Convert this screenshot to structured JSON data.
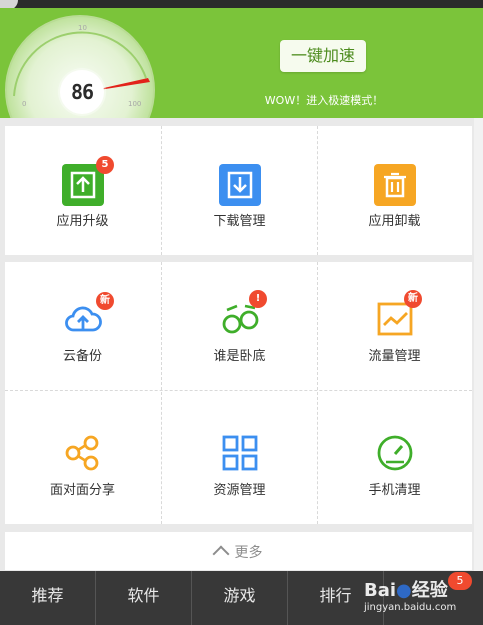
{
  "header": {
    "speed": "86",
    "gauge_ticks": [
      "0",
      "10",
      "100"
    ],
    "boost_button": "一键加速",
    "mode_text": "WOW！进入极速模式！",
    "colors": {
      "header_bg": "#7bc43a",
      "boost_text": "#4d8c1e",
      "needle": "#e2231a"
    }
  },
  "tiles": [
    {
      "label": "应用升级",
      "icon": "upload-box-icon",
      "color": "#3fae2a",
      "badge": "5"
    },
    {
      "label": "下载管理",
      "icon": "download-box-icon",
      "color": "#3c8ff0",
      "badge": ""
    },
    {
      "label": "应用卸载",
      "icon": "trash-icon",
      "color": "#f6a623",
      "badge": ""
    },
    {
      "label": "云备份",
      "icon": "cloud-upload-icon",
      "color": "#3c8ff0",
      "badge": "新"
    },
    {
      "label": "谁是卧底",
      "icon": "spy-glasses-icon",
      "color": "#3fae2a",
      "badge": "!"
    },
    {
      "label": "流量管理",
      "icon": "traffic-chart-icon",
      "color": "#f6a623",
      "badge": "新"
    },
    {
      "label": "面对面分享",
      "icon": "share-icon",
      "color": "#f6a623",
      "badge": ""
    },
    {
      "label": "资源管理",
      "icon": "grid-icon",
      "color": "#3c8ff0",
      "badge": ""
    },
    {
      "label": "手机清理",
      "icon": "speedometer-icon",
      "color": "#3fae2a",
      "badge": ""
    }
  ],
  "more": {
    "label": "更多",
    "icon": "chevron-up-icon"
  },
  "bottom_nav": [
    {
      "label": "推荐"
    },
    {
      "label": "软件"
    },
    {
      "label": "游戏"
    },
    {
      "label": "排行"
    },
    {
      "label": "",
      "badge": "5"
    }
  ],
  "watermark": {
    "brand": "Bai",
    "brand2": "经验",
    "url": "jingyan.baidu.com"
  }
}
